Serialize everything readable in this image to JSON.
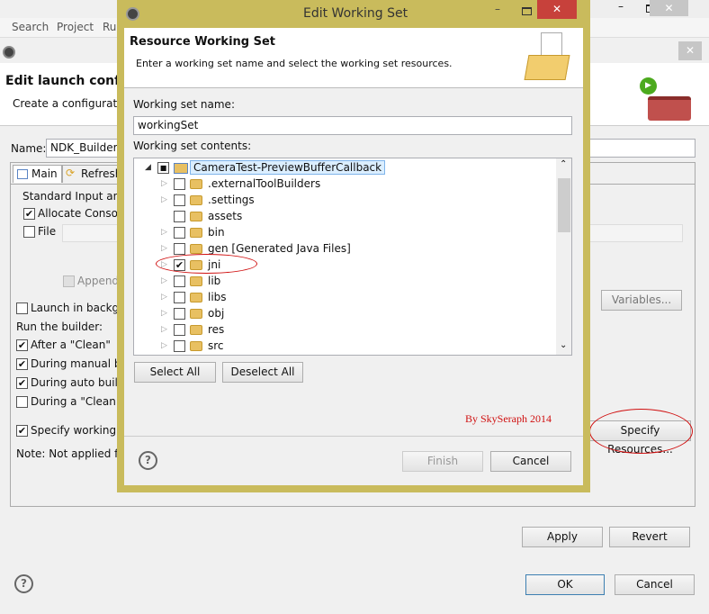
{
  "background": {
    "menu": [
      "Search",
      "Project",
      "Run"
    ],
    "dialog_title": "Edit launch configuration properties",
    "header_title": "Edit launch configu",
    "header_desc": "Create a configuration",
    "name_label": "Name:",
    "name_value": "NDK_Builder",
    "tabs": [
      "Main",
      "Refresh"
    ],
    "group_label": "Standard Input and",
    "allocate_console": "Allocate Console",
    "file_label": "File",
    "append_label": "Append",
    "variables_button": "Variables...",
    "launch_background": "Launch in backgro",
    "run_builder": "Run the builder:",
    "options": [
      {
        "label": "After a \"Clean\"",
        "checked": true
      },
      {
        "label": "During manual bu",
        "checked": true
      },
      {
        "label": "During auto builds",
        "checked": true
      },
      {
        "label": "During a \"Clean\"",
        "checked": false
      }
    ],
    "specify_working_set": "Specify working se",
    "note": "Note: Not applied for",
    "specify_resources_button": "Specify Resources...",
    "apply_button": "Apply",
    "revert_button": "Revert",
    "ok_button": "OK",
    "cancel_button": "Cancel"
  },
  "dialog": {
    "title": "Edit Working Set",
    "header_title": "Resource Working Set",
    "header_desc": "Enter a working set name and select the working set resources.",
    "name_label": "Working set name:",
    "name_value": "workingSet",
    "contents_label": "Working set contents:",
    "root": "CameraTest-PreviewBufferCallback",
    "items": [
      {
        "label": ".externalToolBuilders",
        "checked": false,
        "expandable": true
      },
      {
        "label": ".settings",
        "checked": false,
        "expandable": true
      },
      {
        "label": "assets",
        "checked": false,
        "expandable": false
      },
      {
        "label": "bin",
        "checked": false,
        "expandable": true
      },
      {
        "label": "gen [Generated Java Files]",
        "checked": false,
        "expandable": true
      },
      {
        "label": "jni",
        "checked": true,
        "expandable": true
      },
      {
        "label": "lib",
        "checked": false,
        "expandable": true
      },
      {
        "label": "libs",
        "checked": false,
        "expandable": true
      },
      {
        "label": "obj",
        "checked": false,
        "expandable": true
      },
      {
        "label": "res",
        "checked": false,
        "expandable": true
      },
      {
        "label": "src",
        "checked": false,
        "expandable": true
      }
    ],
    "select_all": "Select All",
    "deselect_all": "Deselect All",
    "watermark": "By SkySeraph 2014",
    "finish_button": "Finish",
    "cancel_button": "Cancel"
  },
  "colors": {
    "frame": "#c9bb5c",
    "close": "#c7413b",
    "annotation": "#d01010"
  }
}
